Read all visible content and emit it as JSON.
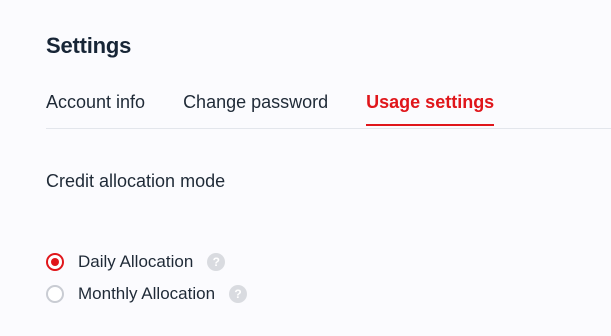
{
  "header": {
    "title": "Settings"
  },
  "tabs": [
    {
      "label": "Account info",
      "active": false
    },
    {
      "label": "Change password",
      "active": false
    },
    {
      "label": "Usage settings",
      "active": true
    }
  ],
  "usage": {
    "section_label": "Credit allocation mode",
    "options": [
      {
        "label": "Daily Allocation",
        "selected": true,
        "help_icon": "question-mark-icon",
        "help_glyph": "?"
      },
      {
        "label": "Monthly Allocation",
        "selected": false,
        "help_icon": "question-mark-icon",
        "help_glyph": "?"
      }
    ]
  },
  "colors": {
    "accent": "#e0161b",
    "text": "#1f2a37",
    "background": "#fbfbfe"
  }
}
